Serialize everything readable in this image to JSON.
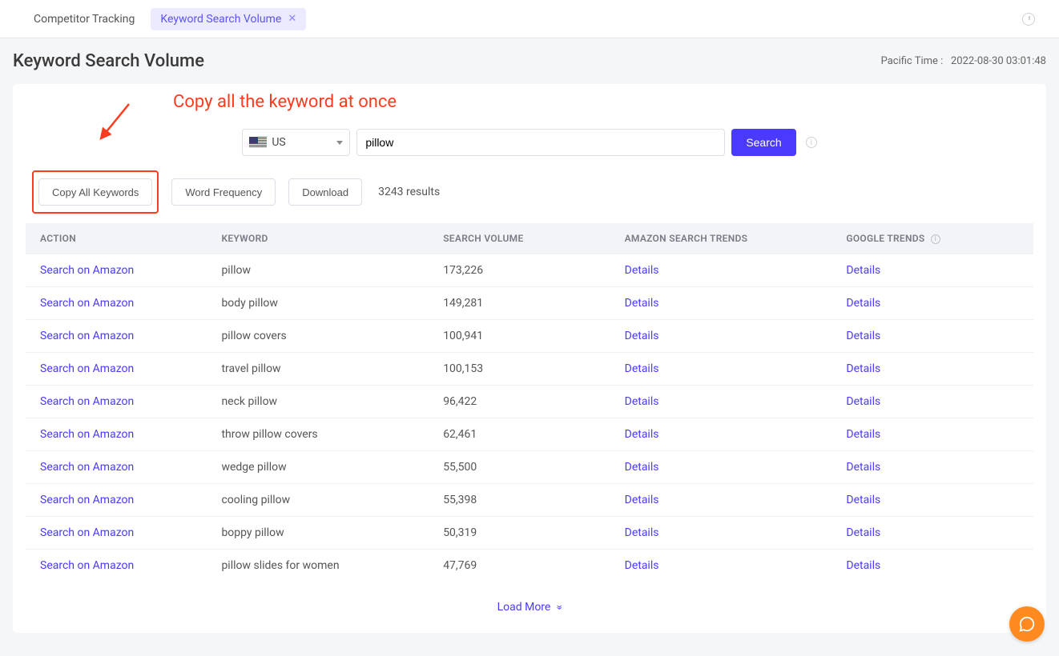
{
  "tabs": {
    "competitor": "Competitor Tracking",
    "keyword_volume": "Keyword Search Volume"
  },
  "page_title": "Keyword Search Volume",
  "timestamp_label": "Pacific Time :",
  "timestamp_value": "2022-08-30 03:01:48",
  "annotation": "Copy all the keyword at once",
  "search": {
    "region": "US",
    "query": "pillow",
    "search_btn": "Search"
  },
  "toolbar": {
    "copy_all": "Copy All Keywords",
    "word_freq": "Word Frequency",
    "download": "Download",
    "results": "3243 results"
  },
  "columns": {
    "action": "ACTION",
    "keyword": "KEYWORD",
    "search_volume": "SEARCH VOLUME",
    "amazon_trends": "AMAZON SEARCH TRENDS",
    "google_trends": "GOOGLE TRENDS"
  },
  "row_labels": {
    "action_link": "Search on Amazon",
    "details": "Details"
  },
  "rows": [
    {
      "keyword": "pillow",
      "volume": "173,226"
    },
    {
      "keyword": "body pillow",
      "volume": "149,281"
    },
    {
      "keyword": "pillow covers",
      "volume": "100,941"
    },
    {
      "keyword": "travel pillow",
      "volume": "100,153"
    },
    {
      "keyword": "neck pillow",
      "volume": "96,422"
    },
    {
      "keyword": "throw pillow covers",
      "volume": "62,461"
    },
    {
      "keyword": "wedge pillow",
      "volume": "55,500"
    },
    {
      "keyword": "cooling pillow",
      "volume": "55,398"
    },
    {
      "keyword": "boppy pillow",
      "volume": "50,319"
    },
    {
      "keyword": "pillow slides for women",
      "volume": "47,769"
    }
  ],
  "load_more": "Load More"
}
